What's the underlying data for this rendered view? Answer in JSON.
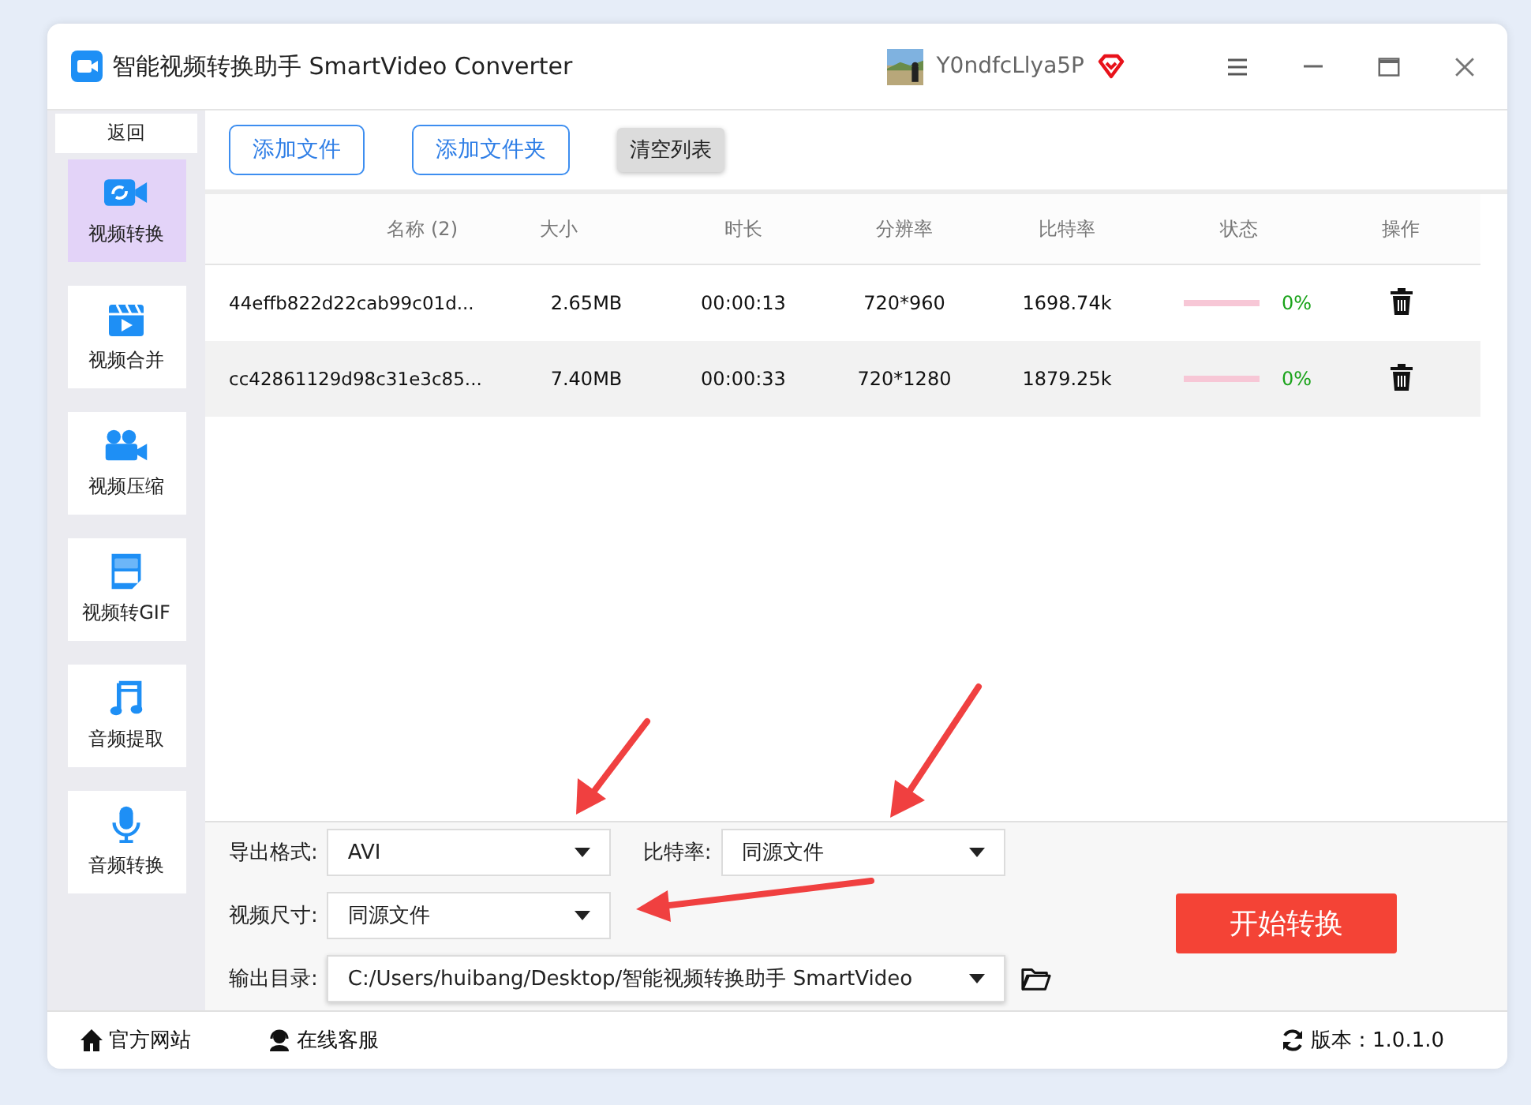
{
  "window": {
    "title": "智能视频转换助手 SmartVideo Converter",
    "username": "Y0ndfcLlya5P"
  },
  "sidebar": {
    "back": "返回",
    "items": [
      {
        "label": "视频转换",
        "kind": "convert",
        "selected": true
      },
      {
        "label": "视频合并",
        "kind": "merge",
        "selected": false
      },
      {
        "label": "视频压缩",
        "kind": "compress",
        "selected": false
      },
      {
        "label": "视频转GIF",
        "kind": "gif",
        "selected": false
      },
      {
        "label": "音频提取",
        "kind": "music",
        "selected": false
      },
      {
        "label": "音频转换",
        "kind": "mic",
        "selected": false
      }
    ]
  },
  "toolbar": {
    "add_file": "添加文件",
    "add_folder": "添加文件夹",
    "clear": "清空列表"
  },
  "table": {
    "columns": [
      "名称 (2)",
      "大小",
      "时长",
      "分辨率",
      "比特率",
      "状态",
      "操作"
    ],
    "rows": [
      {
        "name": "44effb822d22cab99c01d...",
        "size": "2.65MB",
        "duration": "00:00:13",
        "resolution": "720*960",
        "bitrate": "1698.74k",
        "level": 0,
        "percent": "0%"
      },
      {
        "name": "cc42861129d98c31e3c85...",
        "size": "7.40MB",
        "duration": "00:00:33",
        "resolution": "720*1280",
        "bitrate": "1879.25k",
        "level": 0,
        "percent": "0%"
      }
    ]
  },
  "settings": {
    "format_label": "导出格式:",
    "format": "AVI",
    "bitrate_label": "比特率:",
    "bitrate": "同源文件",
    "size_label": "视频尺寸:",
    "size": "同源文件",
    "output_label": "输出目录:",
    "output": "C:/Users/huibang/Desktop/智能视频转换助手 SmartVideo",
    "start": "开始转换"
  },
  "status_bar": {
    "website": "官方网站",
    "support": "在线客服",
    "version": "版本：1.0.1.0"
  }
}
